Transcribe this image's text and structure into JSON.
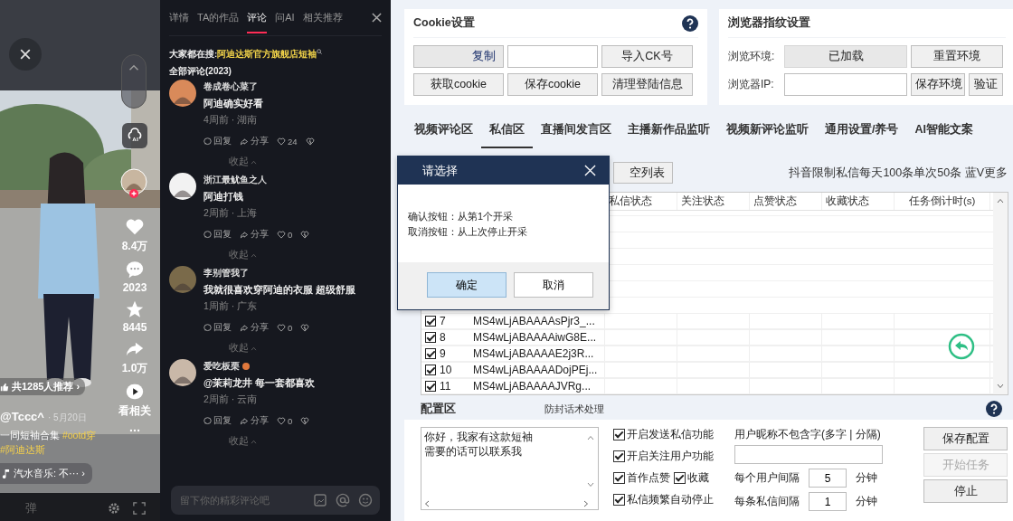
{
  "video": {
    "recommend": "共1285人推荐 ›",
    "author": "@Tccc^",
    "date": "· 5月20日",
    "caption": [
      "一同短袖合集 **#ootd穿**",
      "**#阿迪达斯**"
    ],
    "music": "汽水音乐: 不··· ›",
    "danmaku": "弹",
    "actions": [
      {
        "kind": "like",
        "count": "8.4万"
      },
      {
        "kind": "comment",
        "count": "2023"
      },
      {
        "kind": "star",
        "count": "8445"
      },
      {
        "kind": "share",
        "count": "1.0万"
      },
      {
        "kind": "related",
        "count": "看相关"
      },
      {
        "kind": "more"
      }
    ]
  },
  "comments_panel": {
    "tabs": [
      {
        "label": "详情",
        "selected": false
      },
      {
        "label": "TA的作品",
        "selected": false
      },
      {
        "label": "评论",
        "selected": true
      },
      {
        "label": "问AI",
        "selected": false
      },
      {
        "label": "相关推荐",
        "selected": false
      }
    ],
    "search_label": "大家都在搜:",
    "search_term": "阿迪达斯官方旗舰店短袖",
    "count": "全部评论(2023)",
    "comments": [
      {
        "name": "卷成卷心菜了",
        "text": "阿迪确实好看",
        "meta": "4周前 · 湖南",
        "reply": "回复",
        "share": "分享",
        "likes": "24",
        "collapse": "收起",
        "color": "#d98a5a",
        "badge": false
      },
      {
        "name": "浙江最鱿鱼之人",
        "text": "阿迪打钱",
        "meta": "2周前 · 上海",
        "reply": "回复",
        "share": "分享",
        "likes": "0",
        "collapse": "收起",
        "color": "#f2f2f2",
        "badge": false
      },
      {
        "name": "李别管我了",
        "text": "我就很喜欢穿阿迪的衣服 超级舒服",
        "meta": "1周前 · 广东",
        "reply": "回复",
        "share": "分享",
        "likes": "0",
        "collapse": "收起",
        "color": "#7a6a4a",
        "badge": false
      },
      {
        "name": "爱吃板栗",
        "text": "@茉莉龙井  每一套都喜欢",
        "meta": "2周前 · 云南",
        "reply": "回复",
        "share": "分享",
        "likes": "0",
        "collapse": "收起",
        "color": "#c9b8a8",
        "badge": true
      }
    ],
    "input_placeholder": "留下你的精彩评论吧"
  },
  "cookie": {
    "title": "Cookie设置",
    "copy": "复制",
    "import": "导入CK号",
    "buttons": [
      "获取cookie",
      "保存cookie",
      "清理登陆信息"
    ]
  },
  "browser": {
    "title": "浏览器指纹设置",
    "env_label": "浏览环境:",
    "env_status": "已加载",
    "reset": "重置环境",
    "ip_label": "浏览器IP:",
    "save": "保存环境",
    "verify": "验证"
  },
  "tabs": [
    {
      "label": "视频评论区",
      "selected": false
    },
    {
      "label": "私信区",
      "selected": true
    },
    {
      "label": "直播间发言区",
      "selected": false
    },
    {
      "label": "主播新作品监听",
      "selected": false
    },
    {
      "label": "视频新评论监听",
      "selected": false
    },
    {
      "label": "通用设置/养号",
      "selected": false
    },
    {
      "label": "AI智能文案",
      "selected": false
    }
  ],
  "clear_button": "空列表",
  "notice": "抖音限制私信每天100条单次50条 蓝V更多",
  "table": {
    "columns": [
      "私信状态",
      "关注状态",
      "点赞状态",
      "收藏状态",
      "任务倒计时(s)"
    ],
    "rows": [
      {
        "checked": true,
        "index": "7",
        "id": "MS4wLjABAAAAsPjr3_..."
      },
      {
        "checked": true,
        "index": "8",
        "id": "MS4wLjABAAAAiwG8E..."
      },
      {
        "checked": true,
        "index": "9",
        "id": "MS4wLjABAAAAE2j3R..."
      },
      {
        "checked": true,
        "index": "10",
        "id": "MS4wLjABAAAADojPEj..."
      },
      {
        "checked": true,
        "index": "11",
        "id": "MS4wLjABAAAAJVRg..."
      }
    ]
  },
  "config": {
    "title": "配置区",
    "subtitle": "防封话术处理",
    "message": [
      "你好，我家有这款短袖",
      "需要的话可以联系我"
    ],
    "options": [
      {
        "label": "开启发送私信功能",
        "checked": true
      },
      {
        "label": "开启关注用户功能",
        "checked": true
      },
      {
        "label": "首作点赞",
        "checked": true
      },
      {
        "label": "收藏",
        "checked": true
      },
      {
        "label": "私信频繁自动停止",
        "checked": true
      }
    ],
    "nickname_label": "用户昵称不包含字(多字 | 分隔)",
    "intervals": [
      {
        "label": "每个用户间隔",
        "value": "5",
        "unit": "分钟"
      },
      {
        "label": "每条私信间隔",
        "value": "1",
        "unit": "分钟"
      }
    ],
    "buttons": [
      {
        "label": "保存配置",
        "disabled": false
      },
      {
        "label": "开始任务",
        "disabled": true
      },
      {
        "label": "停止",
        "disabled": false
      }
    ]
  },
  "dialog": {
    "title": "请选择",
    "lines": [
      "确认按钮：从第1个开采",
      "取消按钮：从上次停止开采"
    ],
    "buttons": [
      {
        "label": "确定",
        "selected": true
      },
      {
        "label": "取消",
        "selected": false
      }
    ]
  }
}
